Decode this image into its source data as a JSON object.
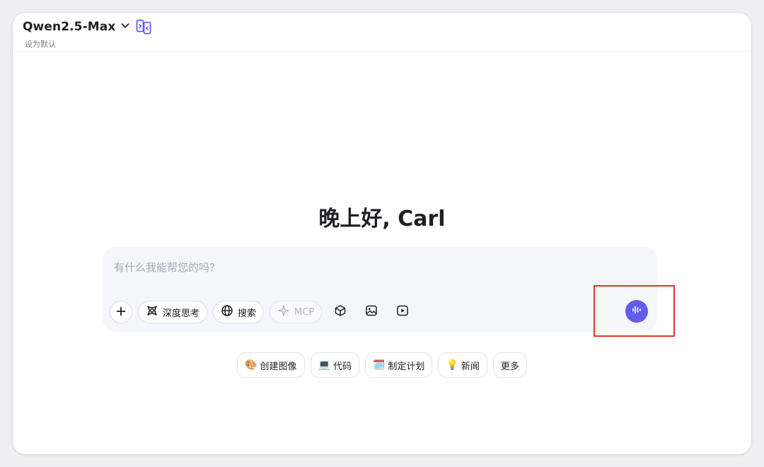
{
  "header": {
    "model_name": "Qwen2.5-Max",
    "set_default_label": "设为默认"
  },
  "greeting": "晚上好, Carl",
  "composer": {
    "placeholder": "有什么我能帮您的吗?",
    "tools": [
      {
        "label": "深度思考",
        "icon": "deep-thinking-icon",
        "enabled": true
      },
      {
        "label": "搜索",
        "icon": "globe-icon",
        "enabled": true
      },
      {
        "label": "MCP",
        "icon": "sparkle-icon",
        "enabled": false
      }
    ],
    "extra_icons": [
      "cube-icon",
      "image-icon",
      "video-icon"
    ],
    "voice_icon": "voice-wave-icon"
  },
  "suggestions": [
    {
      "emoji": "🎨",
      "label": "创建图像"
    },
    {
      "emoji": "💻",
      "label": "代码"
    },
    {
      "emoji": "🗓️",
      "label": "制定计划"
    },
    {
      "emoji": "💡",
      "label": "新闻"
    },
    {
      "emoji": "",
      "label": "更多"
    }
  ],
  "colors": {
    "accent": "#615ced",
    "highlight_box": "#e0362c",
    "composer_bg": "#f5f6fa"
  }
}
